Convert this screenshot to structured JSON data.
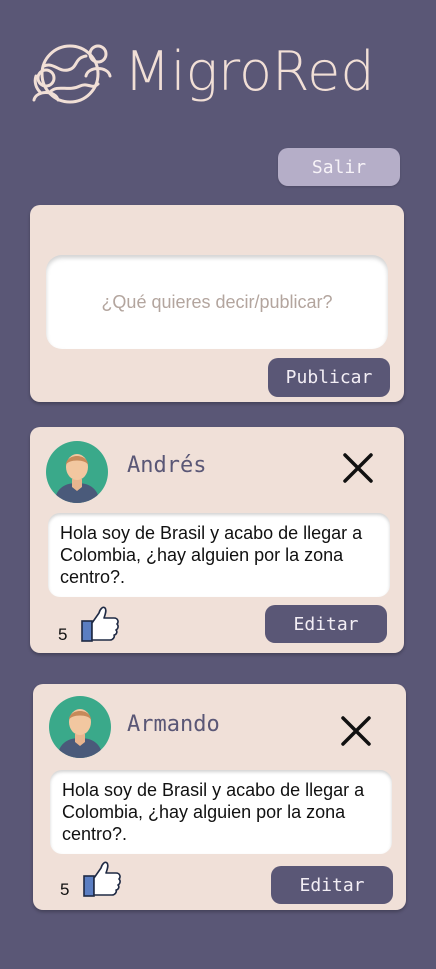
{
  "app": {
    "name": "MigroRed"
  },
  "header": {
    "logout_label": "Salir"
  },
  "composer": {
    "placeholder": "¿Qué quieres decir/publicar?",
    "publish_label": "Publicar"
  },
  "posts": [
    {
      "author": "Andrés",
      "body": "Hola  soy de Brasil y acabo de llegar a Colombia, ¿hay alguien por la zona centro?.",
      "likes": "5",
      "edit_label": "Editar"
    },
    {
      "author": "Armando",
      "body": "Hola  soy de Brasil y acabo de llegar a Colombia, ¿hay alguien por la zona centro?.",
      "likes": "5",
      "edit_label": "Editar"
    }
  ],
  "icons": {
    "logo": "globe-people-icon",
    "avatar": "user-avatar-icon",
    "close": "close-icon",
    "like": "thumbs-up-icon"
  },
  "colors": {
    "background": "#5a5776",
    "card": "#f0e0d8",
    "accent_light": "#b5aec8",
    "text_light": "#f1dfd6",
    "avatar_bg": "#3aa98a"
  }
}
